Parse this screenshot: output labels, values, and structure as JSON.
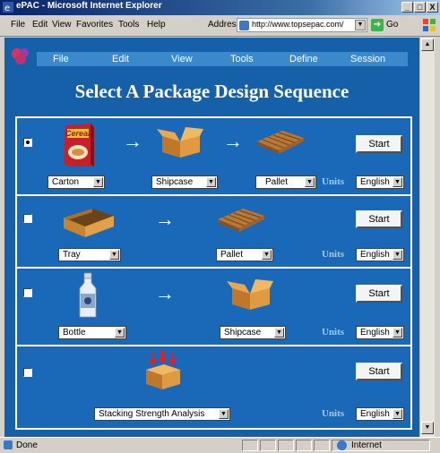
{
  "window": {
    "title": "ePAC - Microsoft Internet Explorer",
    "controls": [
      "_",
      "□",
      "X"
    ]
  },
  "menubar": {
    "items": [
      "File",
      "Edit",
      "View",
      "Favorites",
      "Tools",
      "Help"
    ],
    "address_label": "Address",
    "address_value": "http://www.topsepac.com/",
    "go_label": "Go"
  },
  "app": {
    "nav": [
      "File",
      "Edit",
      "View",
      "Tools",
      "Define",
      "Session"
    ],
    "heading": "Select A Package Design Sequence",
    "start_label": "Start",
    "units_label": "Units",
    "arrow": "→",
    "rows": [
      {
        "selected": true,
        "selects": [
          "Carton",
          "Shipcase",
          "Pallet"
        ],
        "units_value": "English",
        "carton_text": "Cereal"
      },
      {
        "selected": false,
        "selects": [
          "Tray",
          "Pallet"
        ],
        "units_value": "English"
      },
      {
        "selected": false,
        "selects": [
          "Bottle",
          "Shipcase"
        ],
        "units_value": "English"
      },
      {
        "selected": false,
        "selects": [
          "Stacking Strength Analysis"
        ],
        "units_value": "English"
      }
    ]
  },
  "status": {
    "left": "Done",
    "zone": "Internet"
  }
}
